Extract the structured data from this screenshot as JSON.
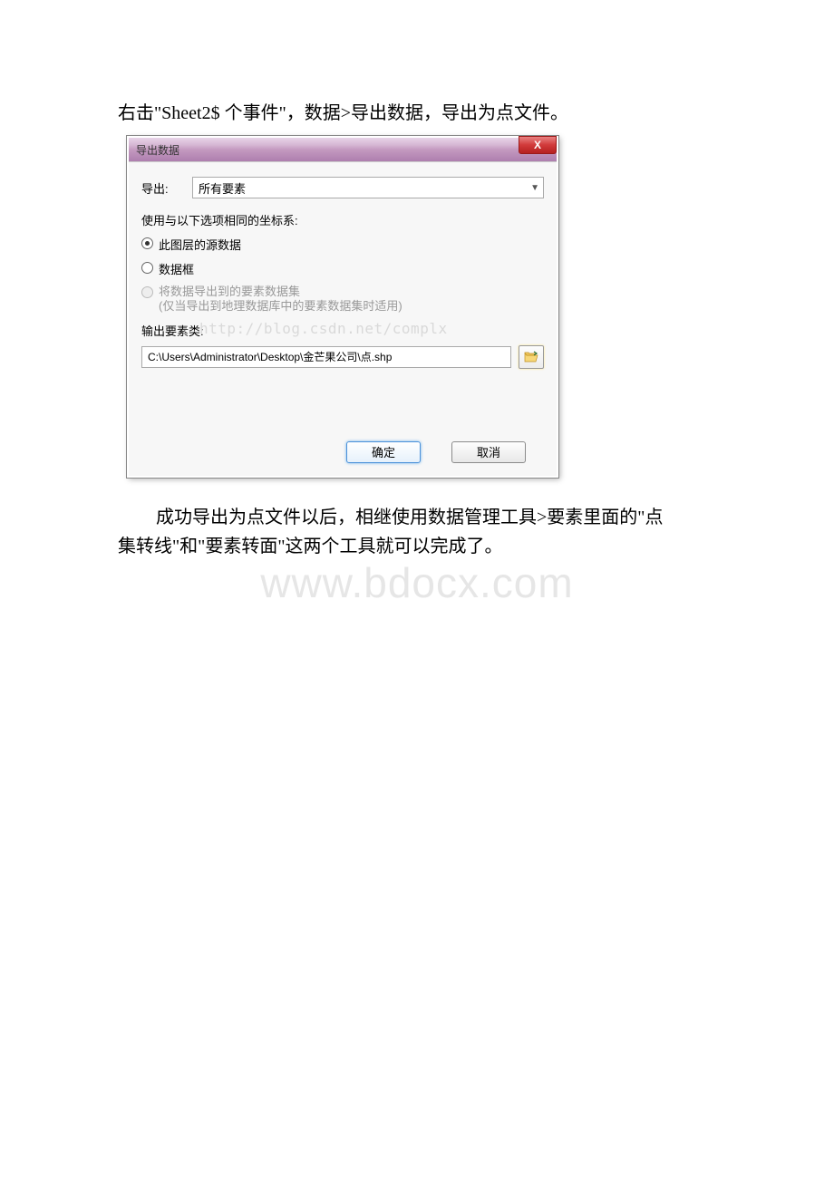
{
  "instruction": "右击\"Sheet2$ 个事件\"，数据>导出数据，导出为点文件。",
  "dialog": {
    "title": "导出数据",
    "close_label": "X",
    "export_label": "导出:",
    "export_value": "所有要素",
    "coord_system_label": "使用与以下选项相同的坐标系:",
    "radio": {
      "source": "此图层的源数据",
      "frame": "数据框",
      "dataset_line1": "将数据导出到的要素数据集",
      "dataset_line2": "(仅当导出到地理数据库中的要素数据集时适用)"
    },
    "watermark_url": "http://blog.csdn.net/complx",
    "output_label": "输出要素类:",
    "output_path": "C:\\Users\\Administrator\\Desktop\\金芒果公司\\点.shp",
    "ok_button": "确定",
    "cancel_button": "取消"
  },
  "followup_line1": "成功导出为点文件以后，相继使用数据管理工具>要素里面的\"点",
  "followup_line2": "集转线\"和\"要素转面\"这两个工具就可以完成了。",
  "big_watermark": "www.bdocx.com"
}
